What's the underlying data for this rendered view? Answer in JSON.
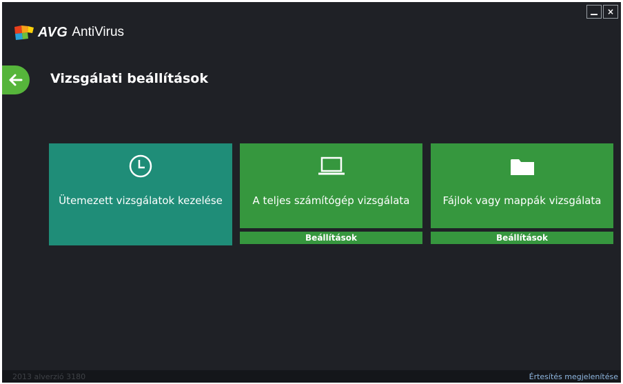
{
  "app": {
    "brand": "AVG",
    "product": "AntiVirus"
  },
  "header": {
    "title": "Vizsgálati beállítások"
  },
  "window_controls": {
    "close_glyph": "×"
  },
  "tiles": [
    {
      "label": "Ütemezett vizsgálatok kezelése",
      "icon": "clock-icon"
    },
    {
      "label": "A teljes számítógép vizsgálata",
      "icon": "laptop-icon",
      "settings_label": "Beállítások"
    },
    {
      "label": "Fájlok vagy mappák vizsgálata",
      "icon": "folder-icon",
      "settings_label": "Beállítások"
    }
  ],
  "footer": {
    "version": "2013  alverzió 3180",
    "notification_link": "Értesítés megjelenítése"
  },
  "colors": {
    "background": "#1f2126",
    "teal_tile": "#1f8d78",
    "green_tile": "#36973e",
    "back_button": "#56b53b",
    "footer_link": "#8fb7e0"
  }
}
